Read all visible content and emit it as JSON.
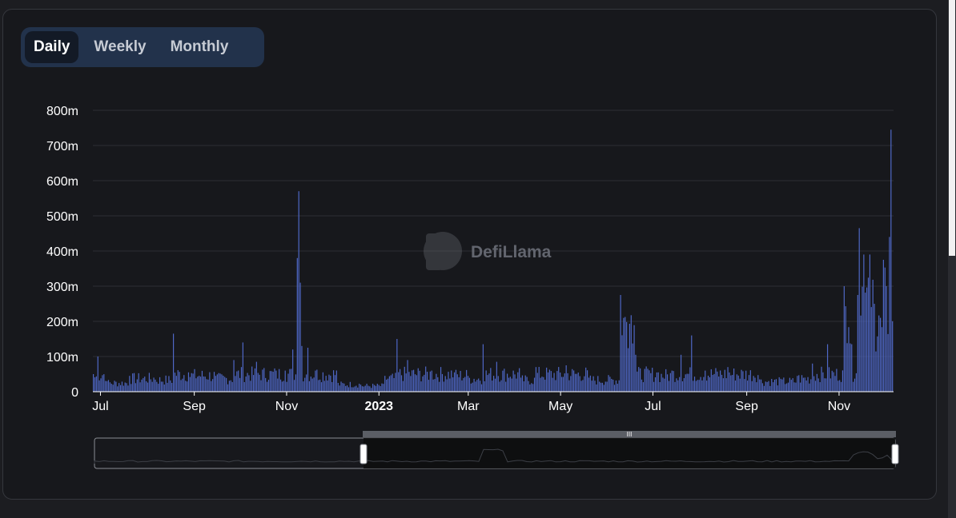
{
  "tabs": [
    {
      "label": "Daily",
      "active": true
    },
    {
      "label": "Weekly",
      "active": false
    },
    {
      "label": "Monthly",
      "active": false
    }
  ],
  "watermark": "DefiLlama",
  "colors": {
    "bar": "#4f68c7",
    "background": "#17181c",
    "grid": "#2c2e33",
    "axis_text": "#ffffff",
    "tab_bg": "#22324b",
    "tab_active_bg": "#131a26"
  },
  "chart_data": {
    "type": "bar",
    "y_ticks": [
      "0",
      "100m",
      "200m",
      "300m",
      "400m",
      "500m",
      "600m",
      "700m",
      "800m"
    ],
    "ylim": [
      0,
      800
    ],
    "y_unit": "m",
    "x_ticks": [
      "Jul",
      "Sep",
      "Nov",
      "2023",
      "Mar",
      "May",
      "Jul",
      "Sep",
      "Nov"
    ],
    "x_range": [
      "2022-06-26",
      "2023-12-07"
    ],
    "grid": true,
    "series": [
      {
        "values_anchor": [
          [
            "2022-06-26",
            50
          ],
          [
            "2022-06-29",
            100
          ],
          [
            "2022-07-05",
            30
          ],
          [
            "2022-07-20",
            45
          ],
          [
            "2022-08-05",
            40
          ],
          [
            "2022-08-18",
            165
          ],
          [
            "2022-08-28",
            55
          ],
          [
            "2022-09-15",
            45
          ],
          [
            "2022-09-27",
            90
          ],
          [
            "2022-10-03",
            140
          ],
          [
            "2022-10-12",
            85
          ],
          [
            "2022-10-25",
            60
          ],
          [
            "2022-10-31",
            60
          ],
          [
            "2022-11-05",
            120
          ],
          [
            "2022-11-08",
            380
          ],
          [
            "2022-11-09",
            570
          ],
          [
            "2022-11-10",
            310
          ],
          [
            "2022-11-11",
            130
          ],
          [
            "2022-11-15",
            125
          ],
          [
            "2022-11-20",
            60
          ],
          [
            "2022-12-05",
            25
          ],
          [
            "2022-12-20",
            20
          ],
          [
            "2023-01-05",
            45
          ],
          [
            "2023-01-13",
            150
          ],
          [
            "2023-01-20",
            90
          ],
          [
            "2023-02-05",
            60
          ],
          [
            "2023-02-20",
            55
          ],
          [
            "2023-03-01",
            45
          ],
          [
            "2023-03-11",
            135
          ],
          [
            "2023-03-20",
            85
          ],
          [
            "2023-04-05",
            40
          ],
          [
            "2023-04-15",
            70
          ],
          [
            "2023-05-05",
            75
          ],
          [
            "2023-05-20",
            40
          ],
          [
            "2023-06-10",
            275
          ],
          [
            "2023-06-20",
            105
          ],
          [
            "2023-07-05",
            55
          ],
          [
            "2023-07-14",
            60
          ],
          [
            "2023-07-20",
            105
          ],
          [
            "2023-07-27",
            160
          ],
          [
            "2023-08-05",
            60
          ],
          [
            "2023-08-20",
            70
          ],
          [
            "2023-09-10",
            35
          ],
          [
            "2023-09-25",
            35
          ],
          [
            "2023-10-05",
            45
          ],
          [
            "2023-10-15",
            80
          ],
          [
            "2023-10-25",
            135
          ],
          [
            "2023-11-05",
            300
          ],
          [
            "2023-11-10",
            135
          ],
          [
            "2023-11-14",
            275
          ],
          [
            "2023-11-15",
            465
          ],
          [
            "2023-11-18",
            390
          ],
          [
            "2023-11-22",
            390
          ],
          [
            "2023-11-25",
            250
          ],
          [
            "2023-11-29",
            210
          ],
          [
            "2023-12-01",
            375
          ],
          [
            "2023-12-03",
            300
          ],
          [
            "2023-12-05",
            440
          ],
          [
            "2023-12-06",
            745
          ],
          [
            "2023-12-07",
            200
          ]
        ]
      }
    ]
  }
}
